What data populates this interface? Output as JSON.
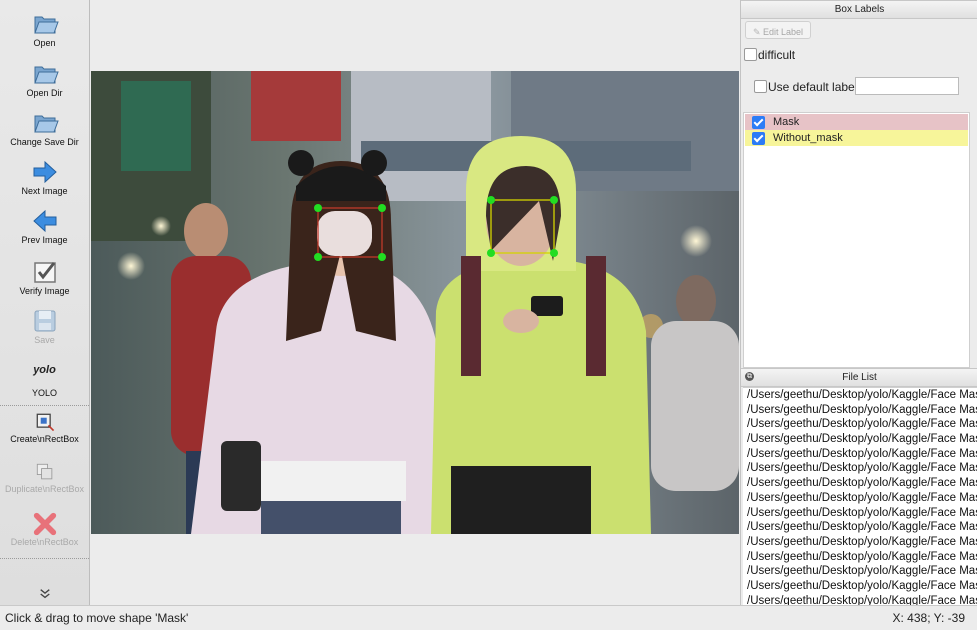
{
  "toolbar": {
    "items": [
      {
        "label": "Open",
        "icon": "folder-open-icon"
      },
      {
        "label": "Open Dir",
        "icon": "folder-open-icon"
      },
      {
        "label": "Change Save Dir",
        "icon": "folder-open-icon"
      },
      {
        "label": "Next Image",
        "icon": "arrow-right-icon"
      },
      {
        "label": "Prev Image",
        "icon": "arrow-left-icon"
      },
      {
        "label": "Verify Image",
        "icon": "checkmark-icon"
      },
      {
        "label": "Save",
        "icon": "floppy-disk-icon"
      },
      {
        "label": "YOLO",
        "icon": "yolo-format-icon",
        "badge": "yolo"
      },
      {
        "label": "Create\\nRectBox",
        "icon": "create-rect-icon"
      },
      {
        "label": "Duplicate\\nRectBox",
        "icon": "duplicate-rect-icon"
      },
      {
        "label": "Delete\\nRectBox",
        "icon": "delete-x-icon"
      }
    ],
    "more_icon": "double-chevron-down-icon"
  },
  "box_labels": {
    "title": "Box Labels",
    "edit_label": "Edit Label",
    "difficult": "difficult",
    "use_default_label": "Use default label",
    "default_label_value": "",
    "labels": [
      {
        "name": "Mask",
        "checked": true,
        "color": "#e7c3c7"
      },
      {
        "name": "Without_mask",
        "checked": true,
        "color": "#f7f59a"
      }
    ]
  },
  "file_list": {
    "title": "File List",
    "files": [
      "/Users/geethu/Desktop/yolo/Kaggle/Face Mask",
      "/Users/geethu/Desktop/yolo/Kaggle/Face Mask",
      "/Users/geethu/Desktop/yolo/Kaggle/Face Mask",
      "/Users/geethu/Desktop/yolo/Kaggle/Face Mask",
      "/Users/geethu/Desktop/yolo/Kaggle/Face Mask",
      "/Users/geethu/Desktop/yolo/Kaggle/Face Mask",
      "/Users/geethu/Desktop/yolo/Kaggle/Face Mask",
      "/Users/geethu/Desktop/yolo/Kaggle/Face Mask",
      "/Users/geethu/Desktop/yolo/Kaggle/Face Mask",
      "/Users/geethu/Desktop/yolo/Kaggle/Face Mask",
      "/Users/geethu/Desktop/yolo/Kaggle/Face Mask",
      "/Users/geethu/Desktop/yolo/Kaggle/Face Mask",
      "/Users/geethu/Desktop/yolo/Kaggle/Face Mask",
      "/Users/geethu/Desktop/yolo/Kaggle/Face Mask",
      "/Users/geethu/Desktop/yolo/Kaggle/Face Mask"
    ]
  },
  "status": {
    "message": "Click & drag to move shape 'Mask'",
    "coords": "X: 438; Y: -39"
  },
  "colors": {
    "box_mask": "#c0392b",
    "box_without_mask": "#d4d400",
    "handle": "#22dd22",
    "checkbox": "#2c7cf6"
  }
}
